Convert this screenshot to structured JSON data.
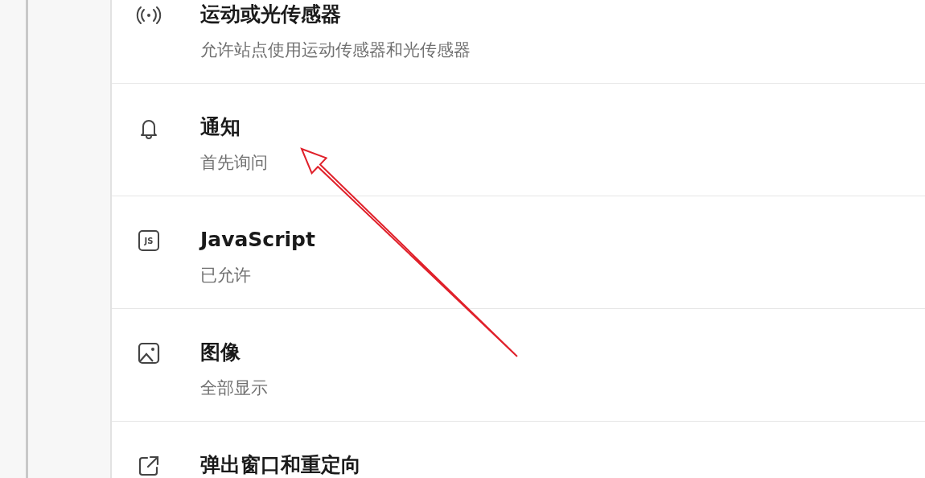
{
  "settings_list": [
    {
      "kind": "sensor",
      "title": "运动或光传感器",
      "subtitle": "允许站点使用运动传感器和光传感器"
    },
    {
      "kind": "bell",
      "title": "通知",
      "subtitle": "首先询问"
    },
    {
      "kind": "js",
      "icon_label": "JS",
      "title": "JavaScript",
      "subtitle": "已允许"
    },
    {
      "kind": "image",
      "title": "图像",
      "subtitle": "全部显示"
    },
    {
      "kind": "popup",
      "title": "弹出窗口和重定向"
    }
  ]
}
